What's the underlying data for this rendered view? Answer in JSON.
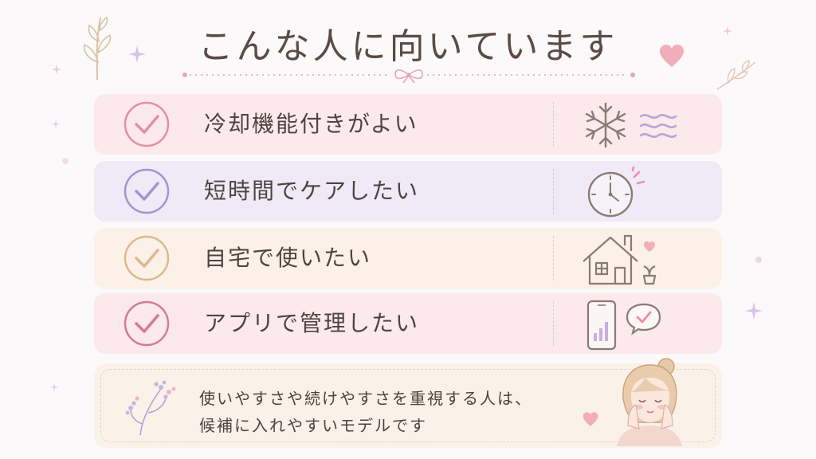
{
  "title": "こんな人に向いています",
  "items": [
    {
      "label": "冷却機能付きがよい",
      "icon": "snowflake-cool-icon",
      "accent": "#e58fa2"
    },
    {
      "label": "短時間でケアしたい",
      "icon": "clock-icon",
      "accent": "#a593cf"
    },
    {
      "label": "自宅で使いたい",
      "icon": "house-icon",
      "accent": "#ddb98c"
    },
    {
      "label": "アプリで管理したい",
      "icon": "smartphone-app-icon",
      "accent": "#d47a97"
    }
  ],
  "note": {
    "line1": "使いやすさや続けやすさを重視する人は、",
    "line2": "候補に入れやすいモデルです"
  },
  "colors": {
    "row_pink": "#fbe9ec",
    "row_lavender": "#efeaf6",
    "row_beige": "#fbf1e8",
    "note_bg": "#faf1e9",
    "text": "#4f4340"
  }
}
